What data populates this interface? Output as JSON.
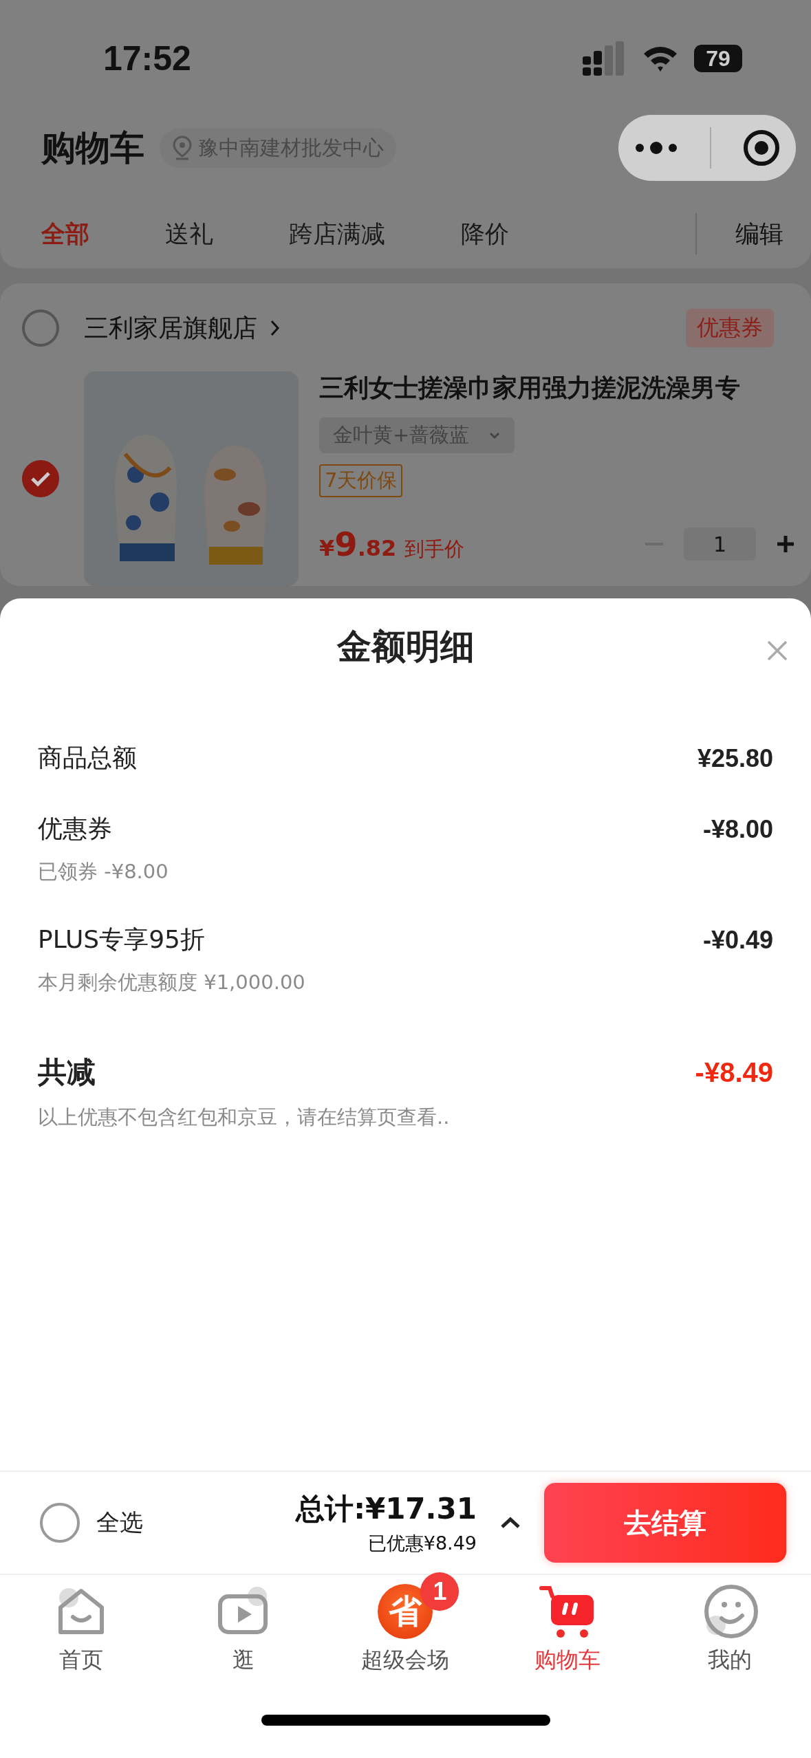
{
  "status_bar": {
    "time": "17:52",
    "battery": "79"
  },
  "header": {
    "title": "购物车",
    "location": "豫中南建材批发中心"
  },
  "tabs": [
    {
      "label": "全部",
      "selected": true
    },
    {
      "label": "送礼",
      "selected": false
    },
    {
      "label": "跨店满减",
      "selected": false
    },
    {
      "label": "降价",
      "selected": false
    }
  ],
  "edit_button": "编辑",
  "store": {
    "checked": false,
    "name": "三利家居旗舰店",
    "coupon_tag": "优惠券"
  },
  "product": {
    "checked": true,
    "title": "三利女士搓澡巾家用强力搓泥洗澡男专",
    "variant": "金叶黄+蔷薇蓝",
    "tag": "7天价保",
    "price_symbol": "¥",
    "price_int": "9",
    "price_dec": ".82",
    "price_label": "到手价",
    "quantity": "1"
  },
  "detail_sheet": {
    "title": "金额明细",
    "rows": [
      {
        "kind": "item",
        "label": "商品总额",
        "value": "¥25.80"
      },
      {
        "kind": "item",
        "label": "优惠券",
        "value": "-¥8.00",
        "note": "已领券 -¥8.00"
      },
      {
        "kind": "item",
        "label": "PLUS专享95折",
        "value": "-¥0.49",
        "note": "本月剩余优惠额度 ¥1,000.00"
      },
      {
        "kind": "total",
        "label": "共减",
        "value": "-¥8.49",
        "note": "以上优惠不包含红包和京豆，请在结算页查看.."
      }
    ]
  },
  "checkout_bar": {
    "select_all": {
      "label": "全选",
      "checked": false
    },
    "total": "总计:¥17.31",
    "saved": "已优惠¥8.49",
    "checkout_button": "去结算"
  },
  "tab_bar": [
    {
      "label": "首页",
      "kind": "home",
      "selected": false
    },
    {
      "label": "逛",
      "kind": "play",
      "selected": false
    },
    {
      "label": "超级会场",
      "kind": "promo",
      "icon_text": "省",
      "badge": "1",
      "selected": false
    },
    {
      "label": "购物车",
      "kind": "cart",
      "selected": true
    },
    {
      "label": "我的",
      "kind": "smile",
      "selected": false
    }
  ]
}
